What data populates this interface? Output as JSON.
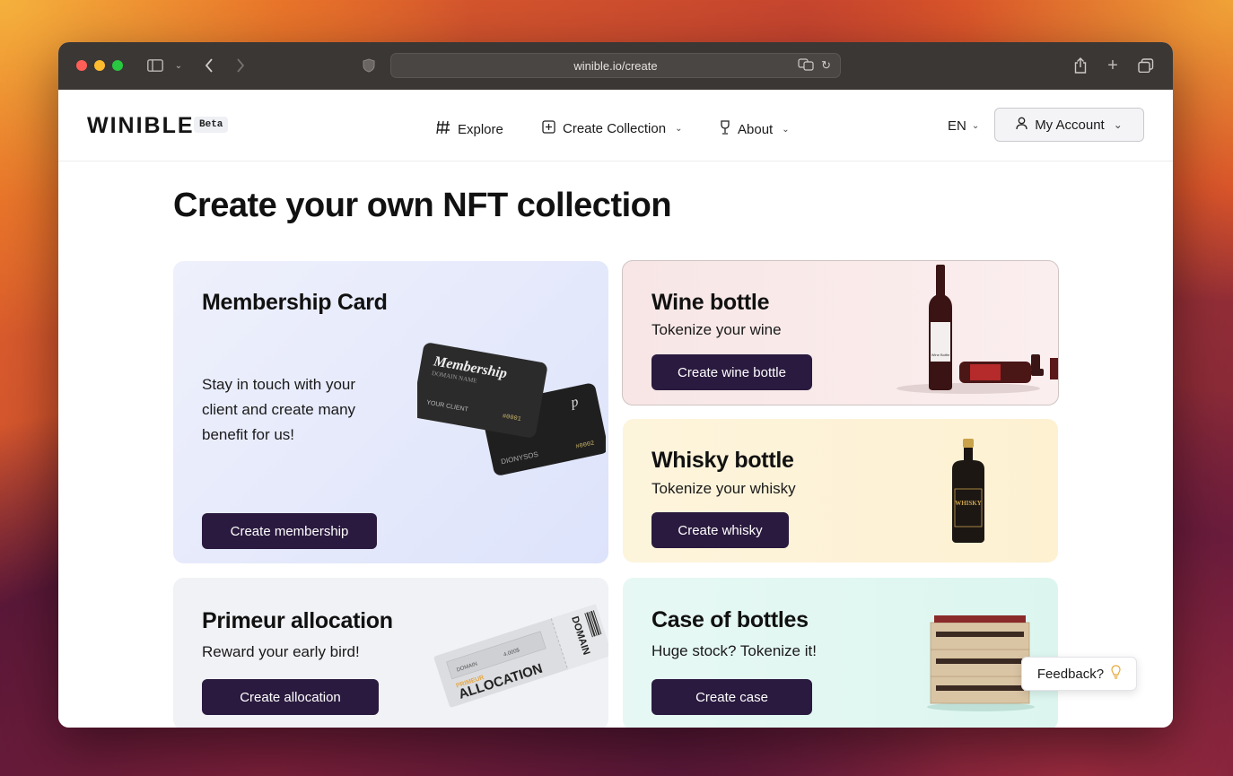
{
  "browser": {
    "url": "winible.io/create"
  },
  "site": {
    "logo": "WINIBLE",
    "badge": "Beta",
    "nav": {
      "explore": "Explore",
      "create_collection": "Create Collection",
      "about": "About"
    },
    "language": "EN",
    "account": "My Account"
  },
  "page": {
    "title": "Create your own NFT collection"
  },
  "cards": {
    "membership": {
      "title": "Membership Card",
      "description": "Stay in touch with your client and create many benefit for us!",
      "button": "Create membership",
      "card_front_title": "Membership",
      "card_front_sub": "DOMAIN NAME",
      "card_front_client": "YOUR CLIENT",
      "card_front_number": "#0001",
      "card_back_client": "DIONYSOS",
      "card_back_number": "#0002"
    },
    "wine": {
      "title": "Wine bottle",
      "subtitle": "Tokenize your wine",
      "button": "Create wine bottle",
      "label": "Wine Bottle"
    },
    "whisky": {
      "title": "Whisky bottle",
      "subtitle": "Tokenize your whisky",
      "button": "Create whisky",
      "label": "WHISKY"
    },
    "primeur": {
      "title": "Primeur allocation",
      "subtitle": "Reward your early bird!",
      "button": "Create allocation",
      "ticket_main": "ALLOCATION",
      "ticket_pre": "PRIMEUR",
      "ticket_domain": "DOMAIN",
      "ticket_amount": "4.000$"
    },
    "case": {
      "title": "Case of bottles",
      "subtitle": "Huge stock? Tokenize it!",
      "button": "Create case"
    }
  },
  "feedback": "Feedback?",
  "colors": {
    "button_bg": "#2a1a3f",
    "membership_bg": "#e3e8fb",
    "wine_bg": "#f8e6e6",
    "whisky_bg": "#fdf4dc",
    "primeur_bg": "#f1f2f6",
    "case_bg": "#e2f7f1"
  }
}
